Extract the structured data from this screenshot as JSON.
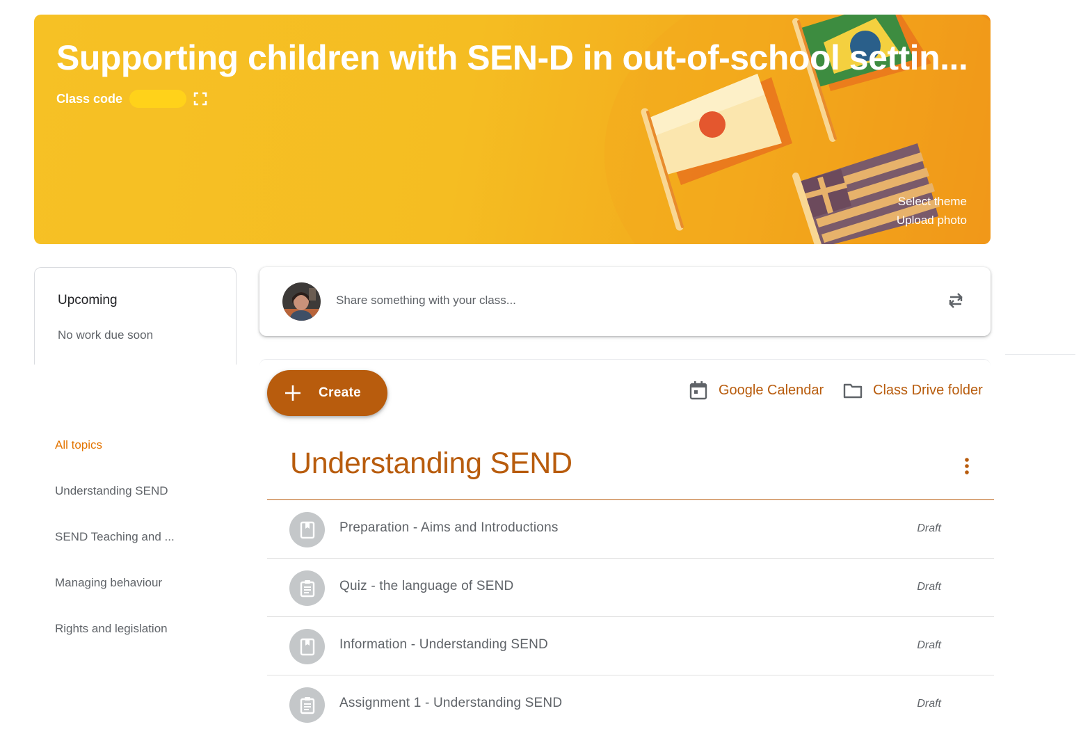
{
  "banner": {
    "title": "Supporting children with SEN-D in out-of-school settin...",
    "class_code_label": "Class code",
    "class_code_value": "hidden",
    "select_theme": "Select theme",
    "upload_photo": "Upload photo",
    "accent_color": "#f6c125"
  },
  "upcoming": {
    "title": "Upcoming",
    "empty_text": "No work due soon"
  },
  "share": {
    "placeholder": "Share something with your class..."
  },
  "toolbar": {
    "create_label": "Create",
    "calendar_label": "Google Calendar",
    "drive_label": "Class Drive folder",
    "accent_color": "#b85c0d"
  },
  "topics_nav": {
    "items": [
      {
        "label": "All topics"
      },
      {
        "label": "Understanding SEND"
      },
      {
        "label": "SEND Teaching and ..."
      },
      {
        "label": "Managing behaviour"
      },
      {
        "label": "Rights and legislation"
      }
    ]
  },
  "topic": {
    "title": "Understanding SEND",
    "items": [
      {
        "title": "Preparation - Aims and Introductions",
        "status": "Draft",
        "icon": "material-icon"
      },
      {
        "title": "Quiz - the language of SEND",
        "status": "Draft",
        "icon": "assignment-icon"
      },
      {
        "title": "Information - Understanding SEND",
        "status": "Draft",
        "icon": "material-icon"
      },
      {
        "title": "Assignment 1 - Understanding SEND",
        "status": "Draft",
        "icon": "assignment-icon"
      }
    ]
  }
}
